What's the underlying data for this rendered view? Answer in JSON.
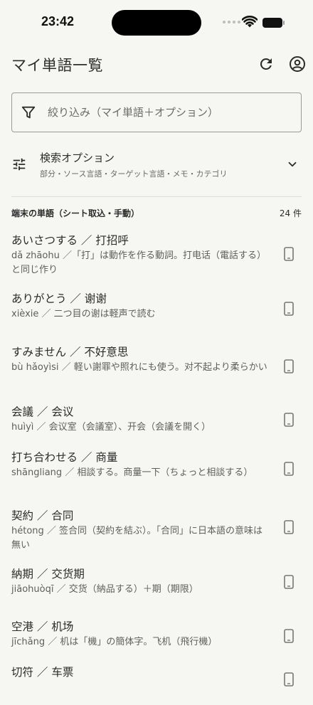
{
  "status": {
    "time": "23:42"
  },
  "header": {
    "title": "マイ単語一覧"
  },
  "filter": {
    "placeholder": "絞り込み（マイ単語＋オプション）"
  },
  "search_options": {
    "title": "検索オプション",
    "subtitle": "部分・ソース言語・ターゲット言語・メモ・カテゴリ"
  },
  "section": {
    "title": "端末の単語（シート取込・手動）",
    "count": "24 件"
  },
  "words": [
    {
      "title": "あいさつする ／ 打招呼",
      "sub": "dǎ zhāohu ／「打」は動作を作る動詞。打电话（電話する）と同じ作り"
    },
    {
      "title": "ありがとう ／ 谢谢",
      "sub": "xièxie ／ 二つ目の谢は軽声で読む"
    },
    {
      "title": "すみません ／ 不好意思",
      "sub": "bù hǎoyìsi ／ 軽い謝罪や照れにも使う。对不起より柔らかい"
    },
    {
      "title": "会議 ／ 会议",
      "sub": "huìyì ／ 会议室（会議室）、开会（会議を開く）"
    },
    {
      "title": "打ち合わせる ／ 商量",
      "sub": "shāngliang ／ 相談する。商量一下（ちょっと相談する）"
    },
    {
      "title": "契約 ／ 合同",
      "sub": "hétong ／ 签合同（契約を結ぶ）。「合同」に日本語の意味は無い"
    },
    {
      "title": "納期 ／ 交货期",
      "sub": "jiāohuòqī ／ 交货（納品する）＋期（期限）"
    },
    {
      "title": "空港 ／ 机场",
      "sub": "jīchǎng ／ 机は「機」の簡体字。飞机（飛行機）"
    },
    {
      "title": "切符 ／ 车票",
      "sub": ""
    }
  ]
}
